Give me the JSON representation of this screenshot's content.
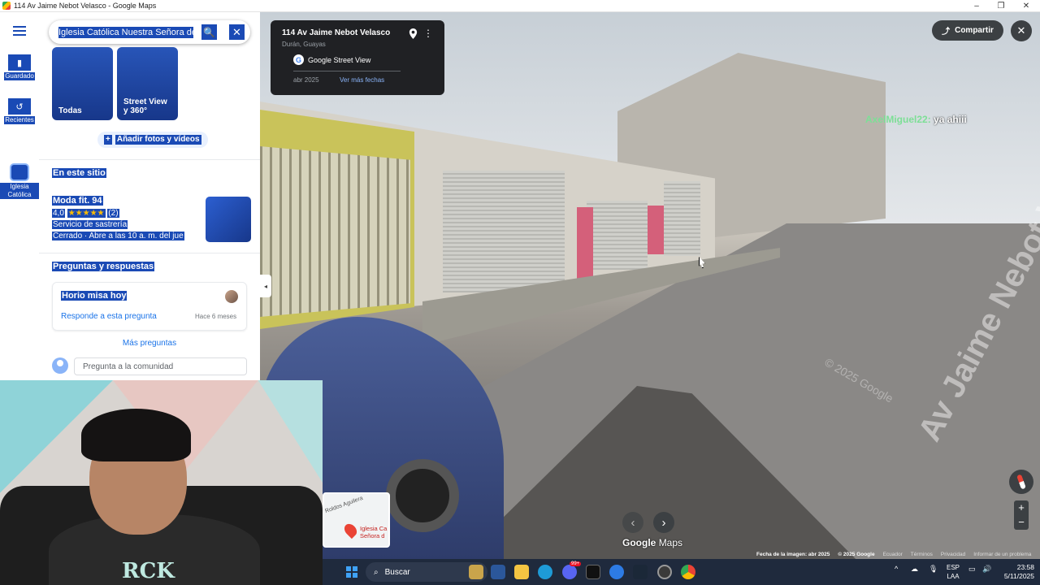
{
  "window": {
    "title": "114 Av Jaime Nebot Velasco - Google Maps",
    "minimize": "–",
    "maximize": "❐",
    "close": "✕"
  },
  "rail": {
    "items": [
      {
        "label": "Guardado",
        "icon": "bookmark-icon"
      },
      {
        "label": "Recientes",
        "icon": "history-icon"
      },
      {
        "label": "Iglesia Católica",
        "icon": "place-thumbnail"
      }
    ]
  },
  "search": {
    "query": "Iglesia Católica Nuestra Señora de L",
    "search_icon": "🔍",
    "close_icon": "✕"
  },
  "photos": [
    {
      "label": "Todas"
    },
    {
      "label": "Street View y 360°"
    }
  ],
  "add_media": {
    "plus": "+",
    "label": "Añadir fotos y vídeos"
  },
  "in_this_place": {
    "title": "En este sitio",
    "business": {
      "name": "Moda fit. 94",
      "rating": "4,0",
      "stars": "★★★★★",
      "stars_value": 4.0,
      "reviews": "(2)",
      "category": "Servicio de sastrería",
      "hours": "Cerrado · Abre a las 10 a. m. del jue"
    }
  },
  "qa": {
    "title": "Preguntas y respuestas",
    "question": "Horio misa hoy",
    "answer_link": "Responde a esta pregunta",
    "when": "Hace 6 meses",
    "more": "Más preguntas",
    "ask_placeholder": "Pregunta a la comunidad"
  },
  "collapse_icon": "◂",
  "streetview": {
    "address": "114 Av Jaime Nebot Velasco",
    "city": "Durán, Guayas",
    "source": "Google Street View",
    "g_letter": "G",
    "date": "abr 2025",
    "more_dates": "Ver más fechas",
    "kebab": "⋮",
    "share": "Compartir",
    "share_icon": "⤴",
    "close": "✕",
    "street_sign": "Av Jaime Nebot Velasco",
    "watermark": "© 2025 Google",
    "chat_user": "AxelMiguel22:",
    "chat_msg": "ya ahiii",
    "prev": "‹",
    "next": "›",
    "brand_google": "Google",
    "brand_maps": "Maps",
    "zoom_in": "+",
    "zoom_out": "−",
    "footer": [
      "Fecha de la imagen: abr 2025",
      "© 2025 Google",
      "Ecuador",
      "Términos",
      "Privacidad",
      "Informar de un problema"
    ]
  },
  "minimap": {
    "road": "Roldos Aguilera",
    "label": "Iglesia Ca Señora d"
  },
  "webcam": {
    "shirt_text": "RCK"
  },
  "taskbar": {
    "search": "Buscar",
    "lang_top": "ESP",
    "lang_bottom": "LAA",
    "time": "23:58",
    "date": "5/11/2025",
    "tray_chevron": "^",
    "badge": "99+"
  },
  "colors": {
    "selection": "#1a4ab5",
    "card_bg": "#202124",
    "link": "#1a73e8",
    "taskbar": "#1f2a3d"
  }
}
